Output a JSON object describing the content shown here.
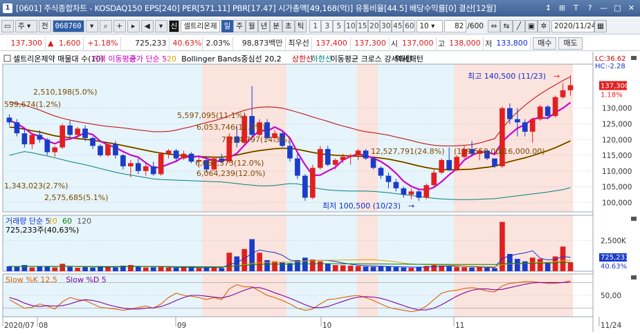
{
  "window": {
    "number": "1",
    "title": "[0601] 주식종합차트 - KOSDAQ150 EPS[240] PER[571.11] PBR[17.47] 시가총액[49,168(억)] 유통비율[44.5] 배당수익률[0] 결산[12월]",
    "controls": [
      "↕",
      "⊞",
      "T",
      "?",
      "—",
      "□",
      "✕"
    ]
  },
  "toolbar": {
    "market": "주",
    "type": "전",
    "code": "068760",
    "stock_name": "셀트리온제",
    "periods": [
      "일",
      "주",
      "월",
      "년",
      "분",
      "초",
      "틱"
    ],
    "active_period": "일",
    "intervals": [
      "1",
      "3",
      "5",
      "10",
      "15",
      "20",
      "30",
      "45",
      "60"
    ],
    "interval_value": "10",
    "page": "82",
    "page_total": "/600",
    "date": "2020/11/24"
  },
  "quote": {
    "price": "137,300",
    "change_sign": "▲",
    "change": "1,600",
    "change_pct": "+1.18%",
    "volume": "725,233",
    "volume_ratio": "40.63%",
    "turnover_pct": "2.03%",
    "amount": "98,873백만",
    "highest_label": "최우선",
    "ask": "137,400",
    "bid": "137,300",
    "open_label": "시",
    "open": "137,000",
    "high_label": "고",
    "high": "138,000",
    "low_label": "저",
    "low": "133,800",
    "buy_btn": "매수",
    "sell_btn": "매도"
  },
  "price_panel": {
    "legend": [
      {
        "text": "셀트리온제약 매물대 수(10)",
        "color": "#000000"
      },
      {
        "text": "가격 이동평균",
        "color": "#cc00cc"
      },
      {
        "text": "종가 단순 5",
        "color": "#cc00cc"
      },
      {
        "text": "20",
        "color": "#e0a000"
      },
      {
        "text": "Bollinger Bands중심선 20,2",
        "color": "#000000"
      },
      {
        "text": "상한선",
        "color": "#c00000"
      },
      {
        "text": "하한선",
        "color": "#008080"
      },
      {
        "text": "이동평균 크로스 강세패턴",
        "color": "#000000"
      },
      {
        "text": "약세패턴",
        "color": "#000000"
      }
    ],
    "annotations": [
      {
        "text": "2,510,198(5.0%)",
        "color": "#7a4a00"
      },
      {
        "text": "599,674(1.2%)",
        "color": "#7a4a00"
      },
      {
        "text": "5,597,095(11.1%)",
        "color": "#7a4a00"
      },
      {
        "text": "6,053,746(12.0%)",
        "color": "#7a4a00"
      },
      {
        "text": "7,214,797(14.3%)",
        "color": "#7a4a00"
      },
      {
        "text": "6,068,373(12.0%)",
        "color": "#7a4a00"
      },
      {
        "text": "6,064,239(12.0%)",
        "color": "#7a4a00"
      },
      {
        "text": "12,527,791(24.8%)",
        "color": "#7a4a00"
      },
      {
        "text": "1,343,023(2.7%)",
        "color": "#7a4a00"
      },
      {
        "text": "2,575,685(5.1%)",
        "color": "#7a4a00"
      },
      {
        "text": "(119,550.00)",
        "color": "#7a4a00"
      },
      {
        "text": "(116,000.00)",
        "color": "#7a4a00"
      },
      {
        "text": "최고 140,500 (11/23)",
        "color": "#1030d0"
      },
      {
        "text": "최저 100,500 (10/23)",
        "color": "#1030d0"
      }
    ],
    "right_top": [
      "LC:36.62",
      "HC:-2.28"
    ],
    "price_tag": "137,300",
    "pct_tag": "1.18%",
    "y_axis": [
      "130,000",
      "125,000",
      "120,000",
      "115,000",
      "110,000",
      "105,000",
      "100,000"
    ]
  },
  "volume_panel": {
    "legend": [
      {
        "text": "거래량 단순 5",
        "color": "#1030d0"
      },
      {
        "text": "20",
        "color": "#e0a000"
      },
      {
        "text": "60",
        "color": "#008000"
      },
      {
        "text": "120",
        "color": "#555555"
      }
    ],
    "value_text": "725,233주(40,63%)",
    "y_axis": [
      "2,500K"
    ],
    "tag_value": "725,233",
    "tag_pct": "40.63%"
  },
  "stoch_panel": {
    "legend": [
      {
        "text": "Slow %K 12,5",
        "color": "#e06000"
      },
      {
        "text": "Slow %D 5",
        "color": "#8000a0"
      }
    ],
    "y_axis": [
      "50,00"
    ]
  },
  "x_axis": {
    "labels": [
      "2020/07",
      "08",
      "09",
      "10",
      "11",
      "11/24"
    ]
  },
  "chart_data": {
    "type": "candlestick",
    "ylim": [
      97000,
      144000
    ],
    "candles": [
      [
        127000,
        128000,
        124500,
        125500
      ],
      [
        125500,
        126500,
        121000,
        122000
      ],
      [
        122000,
        123500,
        117500,
        118500
      ],
      [
        118500,
        122000,
        117000,
        121500
      ],
      [
        121500,
        123000,
        119000,
        120000
      ],
      [
        120000,
        120500,
        115000,
        116000
      ],
      [
        116000,
        118000,
        114500,
        117500
      ],
      [
        117500,
        125000,
        117000,
        124500
      ],
      [
        124500,
        126000,
        120500,
        121500
      ],
      [
        121500,
        124000,
        120000,
        123500
      ],
      [
        123500,
        124500,
        119500,
        120500
      ],
      [
        120500,
        121000,
        117000,
        118000
      ],
      [
        118000,
        118500,
        114500,
        115000
      ],
      [
        115000,
        119000,
        114500,
        118500
      ],
      [
        118500,
        119500,
        114000,
        115000
      ],
      [
        115000,
        115500,
        110500,
        111500
      ],
      [
        111500,
        113500,
        108000,
        112500
      ],
      [
        112500,
        114000,
        109000,
        110000
      ],
      [
        110000,
        112500,
        108500,
        111500
      ],
      [
        111500,
        113000,
        108500,
        109000
      ],
      [
        109000,
        116000,
        108500,
        115500
      ],
      [
        115500,
        117000,
        114000,
        116500
      ],
      [
        116500,
        117000,
        113000,
        114000
      ],
      [
        114000,
        116500,
        113500,
        115500
      ],
      [
        115500,
        116000,
        112500,
        113000
      ],
      [
        113000,
        114500,
        111000,
        113500
      ],
      [
        113500,
        114000,
        109500,
        110500
      ],
      [
        110500,
        114500,
        110000,
        114000
      ],
      [
        114000,
        115500,
        112500,
        113000
      ],
      [
        113000,
        122000,
        112500,
        121000
      ],
      [
        121000,
        124000,
        117500,
        119000
      ],
      [
        119000,
        128500,
        118500,
        127500
      ],
      [
        127500,
        137000,
        120500,
        121500
      ],
      [
        121500,
        126500,
        121000,
        125500
      ],
      [
        125500,
        126500,
        120000,
        120500
      ],
      [
        120500,
        123000,
        119500,
        122000
      ],
      [
        122000,
        122500,
        117500,
        118000
      ],
      [
        118000,
        119500,
        113000,
        114000
      ],
      [
        114000,
        115500,
        107500,
        108500
      ],
      [
        108500,
        109000,
        100500,
        101500
      ],
      [
        101500,
        112000,
        101000,
        111000
      ],
      [
        111000,
        118000,
        110500,
        117000
      ],
      [
        117000,
        118000,
        111500,
        112000
      ],
      [
        112000,
        114000,
        110500,
        113500
      ],
      [
        113500,
        115500,
        112500,
        114500
      ],
      [
        114500,
        115500,
        112000,
        115000
      ],
      [
        115000,
        117000,
        113500,
        116500
      ],
      [
        116500,
        117000,
        113500,
        114000
      ],
      [
        114000,
        114500,
        110500,
        111000
      ],
      [
        111000,
        111500,
        107500,
        108500
      ],
      [
        108500,
        109500,
        104500,
        106500
      ],
      [
        106500,
        107500,
        103500,
        104500
      ],
      [
        104500,
        105000,
        101500,
        102500
      ],
      [
        102500,
        104500,
        101000,
        103500
      ],
      [
        103500,
        104000,
        100500,
        101500
      ],
      [
        101500,
        106000,
        101000,
        105500
      ],
      [
        105500,
        110500,
        105000,
        109500
      ],
      [
        109500,
        114000,
        109000,
        113500
      ],
      [
        113500,
        117500,
        110000,
        110500
      ],
      [
        110500,
        115000,
        110000,
        114500
      ],
      [
        114500,
        118000,
        114000,
        117000
      ],
      [
        117000,
        119500,
        114500,
        115500
      ],
      [
        115500,
        117000,
        113500,
        116500
      ],
      [
        116500,
        117000,
        113500,
        114000
      ],
      [
        114000,
        113500,
        111000,
        111500
      ],
      [
        111500,
        130500,
        111000,
        130000
      ],
      [
        130000,
        131500,
        125000,
        126500
      ],
      [
        126500,
        130000,
        121000,
        125500
      ],
      [
        125500,
        126500,
        121000,
        122500
      ],
      [
        122500,
        127000,
        119000,
        126500
      ],
      [
        126500,
        131000,
        126000,
        130500
      ],
      [
        130500,
        131000,
        126500,
        127500
      ],
      [
        127500,
        134000,
        127000,
        133500
      ],
      [
        133500,
        138000,
        133000,
        135700
      ],
      [
        135700,
        140500,
        134000,
        137300
      ]
    ],
    "volume_k": [
      400,
      350,
      500,
      300,
      420,
      380,
      300,
      600,
      350,
      280,
      330,
      300,
      420,
      360,
      300,
      450,
      500,
      380,
      300,
      320,
      400,
      300,
      280,
      350,
      300,
      260,
      300,
      330,
      250,
      1500,
      1200,
      1800,
      2600,
      1500,
      900,
      800,
      700,
      650,
      900,
      1100,
      950,
      800,
      600,
      500,
      480,
      450,
      420,
      380,
      360,
      400,
      380,
      330,
      300,
      280,
      350,
      420,
      500,
      450,
      380,
      350,
      330,
      300,
      320,
      280,
      250,
      4000,
      1400,
      1000,
      800,
      1100,
      1000,
      700,
      1200,
      2000,
      725
    ],
    "sma5": [
      126000,
      125200,
      123600,
      121800,
      121100,
      119600,
      118700,
      119800,
      120200,
      121000,
      122200,
      121600,
      119500,
      118300,
      117500,
      116200,
      115100,
      114400,
      112600,
      111000,
      111200,
      112200,
      113100,
      114600,
      114400,
      114700,
      114000,
      113300,
      113000,
      114300,
      115600,
      118200,
      120700,
      123000,
      122700,
      124000,
      122800,
      120500,
      115900,
      112000,
      108600,
      108700,
      110000,
      111200,
      113500,
      114700,
      115400,
      114900,
      114100,
      113000,
      111400,
      109300,
      106700,
      105100,
      104200,
      104000,
      104800,
      106600,
      108800,
      110700,
      113500,
      115000,
      116000,
      116000,
      115300,
      119300,
      121600,
      123600,
      124800,
      126500,
      127000,
      126800,
      128600,
      130000,
      131800
    ],
    "sma20": [
      124000,
      123800,
      123300,
      122800,
      122400,
      121800,
      121200,
      120900,
      120600,
      120300,
      120100,
      119800,
      119400,
      119000,
      118600,
      118100,
      117600,
      117100,
      116600,
      116100,
      115700,
      115400,
      115100,
      114900,
      114700,
      114600,
      114500,
      114400,
      114400,
      114700,
      115100,
      115600,
      116100,
      116500,
      116800,
      117100,
      117200,
      117200,
      116900,
      116400,
      115900,
      115500,
      115200,
      115000,
      114900,
      114800,
      114700,
      114600,
      114400,
      114100,
      113800,
      113300,
      112800,
      112200,
      111600,
      111100,
      110700,
      110500,
      110400,
      110400,
      110500,
      110600,
      110900,
      111200,
      111500,
      112300,
      113000,
      113600,
      114200,
      114900,
      115700,
      116500,
      117400,
      118500,
      119600
    ],
    "bb_upper": [
      132000,
      131500,
      131000,
      130200,
      129400,
      128400,
      127500,
      126800,
      126200,
      125700,
      125300,
      124900,
      124500,
      124200,
      124000,
      123700,
      123400,
      123100,
      122800,
      122500,
      122500,
      122600,
      123000,
      123600,
      124100,
      124800,
      125400,
      126000,
      126700,
      127600,
      128500,
      129300,
      129900,
      130300,
      130400,
      130300,
      130000,
      129400,
      128700,
      128000,
      127200,
      126500,
      125800,
      125000,
      124300,
      123700,
      123000,
      122500,
      122200,
      121800,
      121400,
      120800,
      120300,
      119700,
      119100,
      118600,
      118200,
      118000,
      118000,
      118000,
      118200,
      118400,
      118900,
      119600,
      120300,
      123500,
      126400,
      128800,
      130900,
      132800,
      134500,
      136000,
      137400,
      138800,
      140000
    ],
    "bb_lower": [
      115000,
      115600,
      116200,
      115800,
      115300,
      114800,
      114200,
      113600,
      113000,
      112500,
      112000,
      111400,
      110800,
      110200,
      109600,
      109100,
      108700,
      108300,
      107900,
      107500,
      107300,
      107200,
      107100,
      107000,
      106900,
      106800,
      106700,
      106600,
      106500,
      106300,
      106000,
      105700,
      105500,
      105300,
      105300,
      105400,
      105700,
      106000,
      105900,
      105400,
      104800,
      104300,
      104000,
      103800,
      103700,
      103600,
      103600,
      103600,
      103500,
      103300,
      103100,
      102800,
      102500,
      102200,
      101900,
      101600,
      101300,
      101100,
      101000,
      100900,
      100900,
      100900,
      101000,
      101100,
      101200,
      101500,
      101800,
      102100,
      102400,
      102700,
      103000,
      103300,
      103700,
      104100,
      104700
    ],
    "stoch_k": [
      40,
      30,
      20,
      22,
      30,
      25,
      18,
      35,
      45,
      40,
      38,
      30,
      22,
      20,
      18,
      15,
      18,
      22,
      25,
      20,
      30,
      45,
      55,
      50,
      48,
      45,
      40,
      45,
      40,
      65,
      75,
      70,
      70,
      60,
      50,
      45,
      38,
      30,
      20,
      15,
      18,
      30,
      40,
      42,
      45,
      48,
      50,
      45,
      38,
      30,
      22,
      18,
      15,
      12,
      15,
      25,
      40,
      55,
      60,
      62,
      66,
      68,
      65,
      60,
      58,
      72,
      78,
      80,
      82,
      82,
      80,
      78,
      78,
      80,
      84
    ],
    "stoch_d": [
      45,
      40,
      32,
      26,
      24,
      26,
      25,
      26,
      30,
      36,
      40,
      38,
      34,
      28,
      24,
      20,
      18,
      18,
      20,
      21,
      24,
      30,
      38,
      45,
      50,
      50,
      48,
      46,
      44,
      48,
      55,
      62,
      68,
      68,
      63,
      56,
      50,
      43,
      36,
      28,
      22,
      21,
      24,
      30,
      36,
      42,
      46,
      47,
      46,
      43,
      38,
      32,
      26,
      20,
      16,
      16,
      20,
      28,
      38,
      48,
      56,
      62,
      65,
      65,
      63,
      64,
      68,
      72,
      76,
      79,
      80,
      80,
      80,
      80,
      81
    ]
  }
}
